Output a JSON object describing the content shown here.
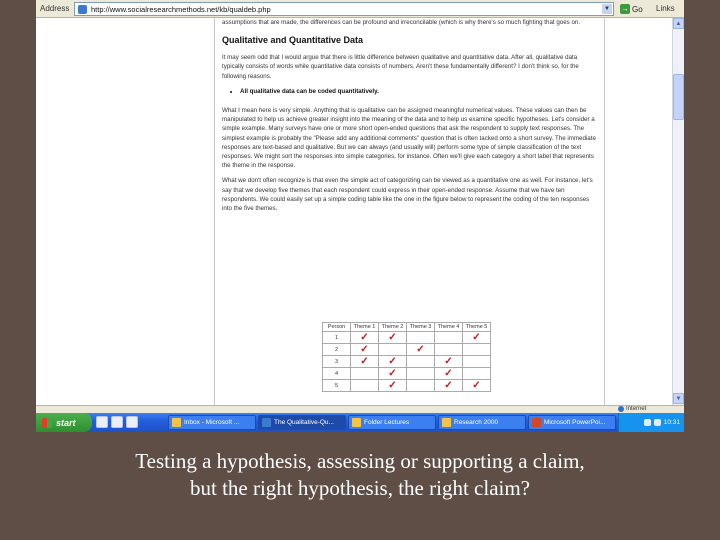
{
  "browser": {
    "address_label": "Address",
    "url": "http://www.socialresearchmethods.net/kb/qualdeb.php",
    "go_label": "Go",
    "links_label": "Links"
  },
  "page": {
    "intro_text": "assumptions that are made, the differences can be profound and irreconcilable (which is why there's so much fighting that goes on.",
    "heading": "Qualitative and Quantitative Data",
    "para1": "It may seem odd that I would argue that there is little difference between qualitative and quantitative data. After all, qualitative data typically consists of words while quantitative data consists of numbers. Aren't these fundamentally different? I don't think so, for the following reasons.",
    "bullet1": "All qualitative data can be coded quantitatively.",
    "para2": "What I mean here is very simple. Anything that is qualitative can be assigned meaningful numerical values. These values can then be manipulated to help us achieve greater insight into the meaning of the data and to help us examine specific hypotheses. Let's consider a simple example. Many surveys have one or more short open-ended questions that ask the respondent to supply text responses. The simplest example is probably the \"Please add any additional comments\" question that is often tacked onto a short survey. The immediate responses are text-based and qualitative. But we can always (and usually will) perform some type of simple classification of the text responses. We might sort the responses into simple categories, for instance. Often we'll give each category a short label that represents the theme in the response.",
    "para3": "What we don't often recognize is that even the simple act of categorizing can be viewed as a quantitative one as well. For instance, let's say that we develop five themes that each respondent could express in their open-ended response. Assume that we have ten respondents. We could easily set up a simple coding table like the one in the figure below to represent the coding of the ten responses into the five themes."
  },
  "coding_table": {
    "headers": [
      "Person",
      "Theme 1",
      "Theme 2",
      "Theme 3",
      "Theme 4",
      "Theme 5"
    ],
    "check_glyph": "✓",
    "rows": [
      {
        "person": "1",
        "checks": [
          true,
          true,
          false,
          false,
          true
        ]
      },
      {
        "person": "2",
        "checks": [
          true,
          false,
          true,
          false,
          false
        ]
      },
      {
        "person": "3",
        "checks": [
          true,
          true,
          false,
          true,
          false
        ]
      },
      {
        "person": "4",
        "checks": [
          false,
          true,
          false,
          true,
          false
        ]
      },
      {
        "person": "5",
        "checks": [
          false,
          true,
          false,
          true,
          true
        ]
      }
    ]
  },
  "status": {
    "zone_label": "Internet"
  },
  "taskbar": {
    "start_label": "start",
    "buttons": [
      {
        "label": "Inbox - Microsoft ..."
      },
      {
        "label": "The Qualitative-Qu..."
      },
      {
        "label": "Folder Lectures"
      },
      {
        "label": "Research 2000"
      },
      {
        "label": "Microsoft PowerPoi..."
      }
    ],
    "clock": "10:31"
  },
  "caption": {
    "line1": "Testing a hypothesis, assessing or supporting a claim,",
    "line2": "but the right hypothesis, the right claim?"
  },
  "colors": {
    "slide_background": "#5e4e46",
    "check_color": "#c41818",
    "taskbar_blue": "#245edb",
    "start_green": "#3c9a3c"
  }
}
